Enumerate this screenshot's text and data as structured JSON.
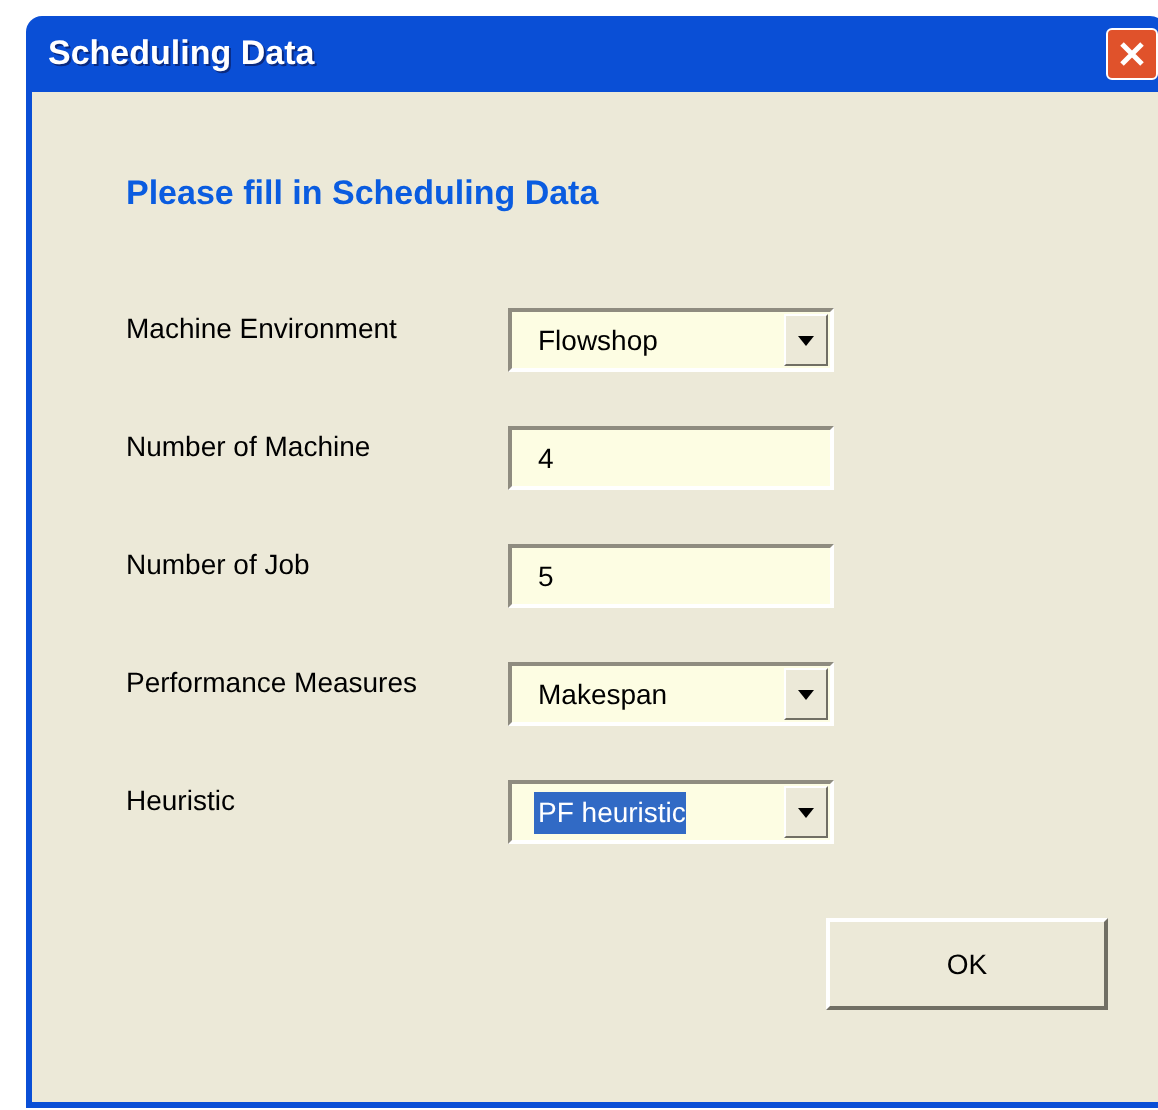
{
  "window": {
    "title": "Scheduling Data"
  },
  "heading": "Please fill in Scheduling Data",
  "fields": [
    {
      "label": "Machine Environment",
      "kind": "dropdown",
      "value": "Flowshop",
      "highlighted": false
    },
    {
      "label": "Number of Machine",
      "kind": "text",
      "value": "4",
      "highlighted": false
    },
    {
      "label": "Number of Job",
      "kind": "text",
      "value": "5",
      "highlighted": false
    },
    {
      "label": "Performance Measures",
      "kind": "dropdown",
      "value": "Makespan",
      "highlighted": false
    },
    {
      "label": "Heuristic",
      "kind": "dropdown",
      "value": "PF heuristic",
      "highlighted": true
    }
  ],
  "buttons": [
    "OK"
  ]
}
